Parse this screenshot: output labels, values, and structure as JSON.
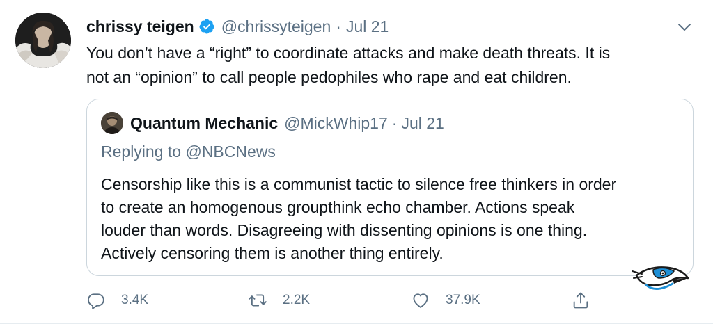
{
  "author": {
    "name": "chrissy teigen",
    "handle": "@chrissyteigen",
    "separator": "·",
    "date": "Jul 21",
    "verified_icon": "verified-badge-icon"
  },
  "tweet": {
    "text_line1": "You don’t have a “right” to coordinate attacks and make death threats. It is",
    "text_line2": "not an “opinion” to call people pedophiles who rape and eat children."
  },
  "quoted": {
    "name": "Quantum Mechanic",
    "handle": "@MickWhip17",
    "separator": "·",
    "date": "Jul 21",
    "replying_prefix": "Replying to",
    "replying_to": "@NBCNews",
    "line1": "Censorship like this is a communist tactic to silence free thinkers in order",
    "line2": "to create an homogenous groupthink echo chamber. Actions speak",
    "line3": "louder than words. Disagreeing with dissenting opinions is one thing.",
    "line4": "Actively censoring them is another thing entirely."
  },
  "actions": {
    "reply_count": "3.4K",
    "retweet_count": "2.2K",
    "like_count": "37.9K"
  },
  "colors": {
    "accent": "#1da1f2",
    "muted_text": "#5b7083",
    "border": "#ccd6dd"
  }
}
